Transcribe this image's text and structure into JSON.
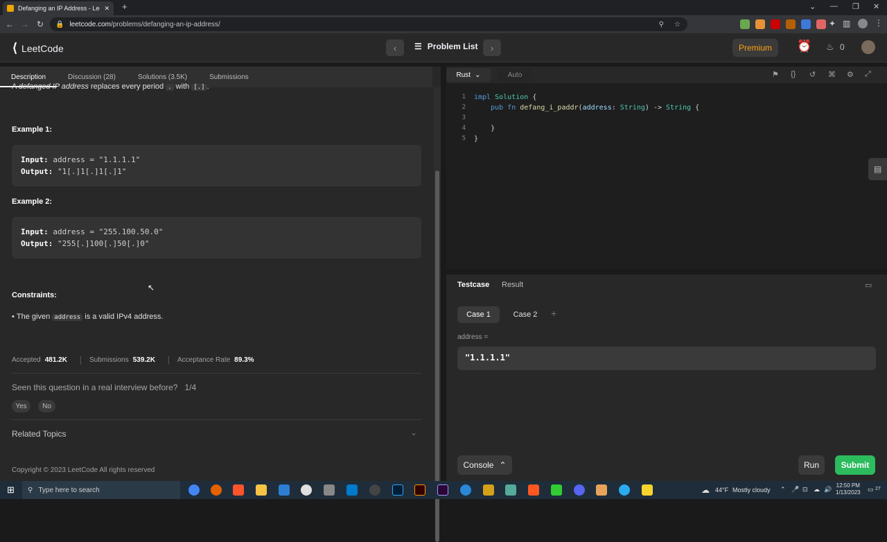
{
  "browser": {
    "tab_title": "Defanging an IP Address - LeetC",
    "url_domain": "leetcode.com",
    "url_path": "/problems/defanging-an-ip-address/"
  },
  "header": {
    "logo_text": "LeetCode",
    "problem_list": "Problem List",
    "premium": "Premium",
    "streak_count": "0"
  },
  "left": {
    "tabs": [
      "Description",
      "Discussion (28)",
      "Solutions (3.5K)",
      "Submissions"
    ],
    "intro_a": "A ",
    "intro_em": "defanged IP address",
    "intro_b": " replaces every period ",
    "intro_code1": ".",
    "intro_c": " with ",
    "intro_code2": "[.]",
    "intro_d": ".",
    "example1_title": "Example 1:",
    "example1_input_label": "Input:",
    "example1_input": "address = \"1.1.1.1\"",
    "example1_output_label": "Output:",
    "example1_output": "\"1[.]1[.]1[.]1\"",
    "example2_title": "Example 2:",
    "example2_input_label": "Input:",
    "example2_input": "address = \"255.100.50.0\"",
    "example2_output_label": "Output:",
    "example2_output": "\"255[.]100[.]50[.]0\"",
    "constraints_title": "Constraints:",
    "constraint_a": "The given ",
    "constraint_code": "address",
    "constraint_b": " is a valid IPv4 address.",
    "accepted_label": "Accepted",
    "accepted_value": "481.2K",
    "submissions_label": "Submissions",
    "submissions_value": "539.2K",
    "rate_label": "Acceptance Rate",
    "rate_value": "89.3%",
    "interview_q": "Seen this question in a real interview before?",
    "interview_count": "1/4",
    "yes": "Yes",
    "no": "No",
    "related": "Related Topics",
    "copyright": "Copyright © 2023 LeetCode All rights reserved"
  },
  "editor": {
    "language": "Rust",
    "auto": "Auto",
    "line_numbers": [
      "1",
      "2",
      "3",
      "4",
      "5"
    ]
  },
  "testcase": {
    "tab_testcase": "Testcase",
    "tab_result": "Result",
    "case1": "Case 1",
    "case2": "Case 2",
    "var_label": "address =",
    "var_value": "\"1.1.1.1\"",
    "console": "Console",
    "run": "Run",
    "submit": "Submit"
  },
  "taskbar": {
    "search_placeholder": "Type here to search",
    "weather_temp": "44°F",
    "weather_text": "Mostly cloudy",
    "time": "12:50 PM",
    "date": "1/13/2023",
    "notif": "27"
  },
  "colors": {
    "accent": "#ffa116",
    "submit": "#2cbb5d"
  }
}
